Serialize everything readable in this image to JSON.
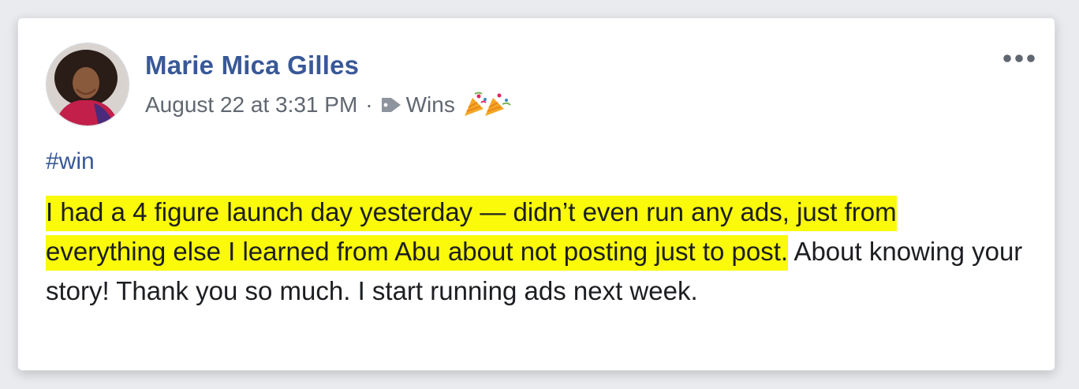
{
  "post": {
    "author": "Marie Mica Gilles",
    "timestamp": "August 22 at 3:31 PM",
    "separator": "·",
    "topic": "Wins",
    "topic_icon": "tag-icon",
    "celebration_icon": "party-popper-icon",
    "hashtag": "#win",
    "highlighted_text": "I had a 4 figure launch day yesterday — didn’t even run any ads, just from everything else I learned from Abu about not posting just to post.",
    "plain_text": " About knowing your story! Thank you so much. I start running ads next week.",
    "highlight_color": "#fafa0a",
    "link_color": "#385898"
  }
}
